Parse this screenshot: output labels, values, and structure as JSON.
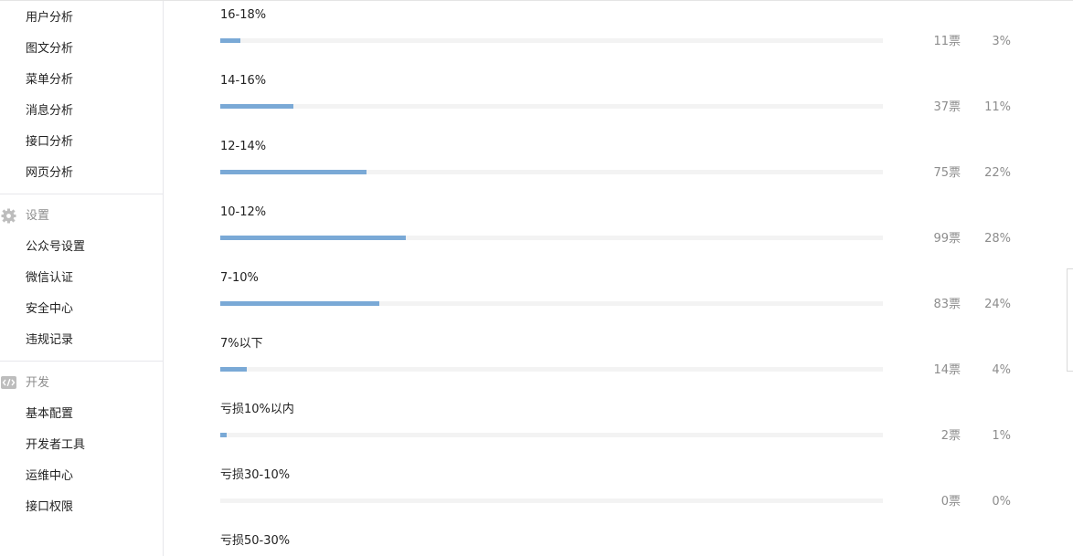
{
  "sidebar": {
    "stats_items": [
      {
        "label": "用户分析"
      },
      {
        "label": "图文分析"
      },
      {
        "label": "菜单分析"
      },
      {
        "label": "消息分析"
      },
      {
        "label": "接口分析"
      },
      {
        "label": "网页分析"
      }
    ],
    "settings": {
      "title": "设置",
      "icon": "gear-icon",
      "items": [
        {
          "label": "公众号设置"
        },
        {
          "label": "微信认证"
        },
        {
          "label": "安全中心"
        },
        {
          "label": "违规记录"
        }
      ]
    },
    "develop": {
      "title": "开发",
      "icon": "code-icon",
      "items": [
        {
          "label": "基本配置"
        },
        {
          "label": "开发者工具"
        },
        {
          "label": "运维中心"
        },
        {
          "label": "接口权限"
        }
      ]
    }
  },
  "poll": {
    "options": [
      {
        "label": "16-18%",
        "votes": "11票",
        "percent": "3%",
        "fraction": 0.03
      },
      {
        "label": "14-16%",
        "votes": "37票",
        "percent": "11%",
        "fraction": 0.11
      },
      {
        "label": "12-14%",
        "votes": "75票",
        "percent": "22%",
        "fraction": 0.22
      },
      {
        "label": "10-12%",
        "votes": "99票",
        "percent": "28%",
        "fraction": 0.28
      },
      {
        "label": "7-10%",
        "votes": "83票",
        "percent": "24%",
        "fraction": 0.24
      },
      {
        "label": "7%以下",
        "votes": "14票",
        "percent": "4%",
        "fraction": 0.04
      },
      {
        "label": "亏损10%以内",
        "votes": "2票",
        "percent": "1%",
        "fraction": 0.01
      },
      {
        "label": "亏损30-10%",
        "votes": "0票",
        "percent": "0%",
        "fraction": 0.0
      },
      {
        "label": "亏损50-30%",
        "votes": "",
        "percent": "",
        "fraction": null
      }
    ]
  },
  "colors": {
    "bar_fill": "#7aa9d6",
    "bar_track": "#f3f3f3",
    "muted_text": "#8d8d8d",
    "section_icon": "#bdbdbd"
  }
}
